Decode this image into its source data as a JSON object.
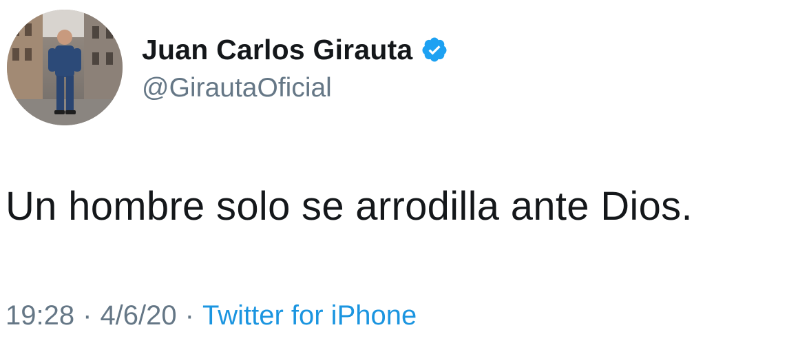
{
  "author": {
    "name": "Juan Carlos Girauta",
    "handle": "@GirautaOficial",
    "verified": true,
    "verified_icon": "verified-badge-icon",
    "avatar_icon": "profile-photo"
  },
  "tweet": {
    "text": "Un hombre solo se arrodilla ante Dios."
  },
  "meta": {
    "time": "19:28",
    "separator": "·",
    "date": "4/6/20",
    "source": "Twitter for iPhone"
  },
  "colors": {
    "text": "#14171a",
    "secondary": "#657786",
    "link": "#1b95e0",
    "verified": "#1da1f2"
  }
}
